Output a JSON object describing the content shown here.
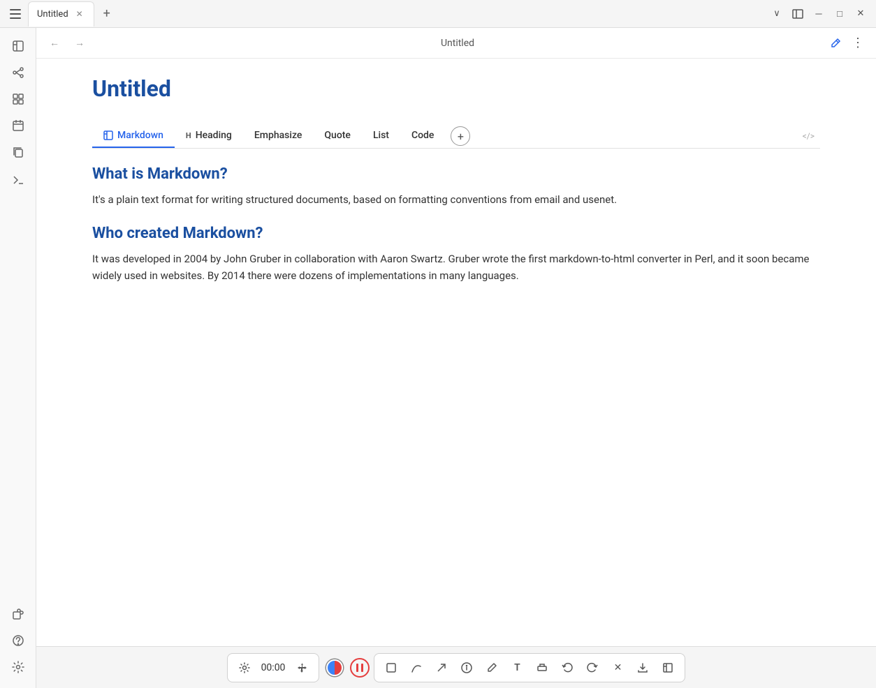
{
  "titleBar": {
    "tabTitle": "Untitled",
    "windowTitle": "Untitled",
    "sidebarToggleIcon": "▣",
    "chevronDownIcon": "∨",
    "layoutIcon": "⊞",
    "minimizeIcon": "─",
    "maximizeIcon": "□",
    "closeIcon": "✕",
    "newTabIcon": "+",
    "editIcon": "✎",
    "moreIcon": "⋮"
  },
  "sidebar": {
    "icons": [
      {
        "name": "pages-icon",
        "symbol": "⊡",
        "interactable": true
      },
      {
        "name": "connections-icon",
        "symbol": "⚯",
        "interactable": true
      },
      {
        "name": "blocks-icon",
        "symbol": "⊞",
        "interactable": true
      },
      {
        "name": "calendar-icon",
        "symbol": "▦",
        "interactable": true
      },
      {
        "name": "copy-icon",
        "symbol": "⧉",
        "interactable": true
      },
      {
        "name": "terminal-icon",
        "symbol": ">_",
        "interactable": true
      }
    ],
    "bottomIcons": [
      {
        "name": "plugin-icon",
        "symbol": "⊕",
        "interactable": true
      },
      {
        "name": "help-icon",
        "symbol": "?",
        "interactable": true
      },
      {
        "name": "settings-icon",
        "symbol": "⚙",
        "interactable": true
      }
    ]
  },
  "nav": {
    "backLabel": "←",
    "forwardLabel": "→",
    "title": "Untitled"
  },
  "document": {
    "title": "Untitled",
    "tabs": [
      {
        "id": "markdown",
        "label": "Markdown",
        "icon": "□",
        "active": true
      },
      {
        "id": "heading",
        "label": "Heading",
        "prefix": "H"
      },
      {
        "id": "emphasize",
        "label": "Emphasize"
      },
      {
        "id": "quote",
        "label": "Quote"
      },
      {
        "id": "list",
        "label": "List"
      },
      {
        "id": "code",
        "label": "Code"
      }
    ],
    "codeToggle": "</>",
    "addTabIcon": "+",
    "sections": [
      {
        "heading": "What is Markdown?",
        "body": "It's a plain text format for writing structured documents, based on formatting conventions from email and usenet."
      },
      {
        "heading": "Who created Markdown?",
        "body": "It was developed in 2004 by John Gruber in collaboration with Aaron Swartz. Gruber wrote the first markdown-to-html converter in Perl, and it soon became widely used in websites. By 2014 there were dozens of implementations in many languages."
      }
    ]
  },
  "bottomToolbar": {
    "timer": "00:00",
    "tools": [
      {
        "name": "settings-tool",
        "symbol": "⚙"
      },
      {
        "name": "move-tool",
        "symbol": "✛"
      },
      {
        "name": "select-tool",
        "symbol": "⬚"
      },
      {
        "name": "curve-tool",
        "symbol": "↝"
      },
      {
        "name": "arrow-tool",
        "symbol": "↗"
      },
      {
        "name": "info-tool",
        "symbol": "ⓘ"
      },
      {
        "name": "pen-tool",
        "symbol": "✏"
      },
      {
        "name": "text-tool",
        "symbol": "T"
      },
      {
        "name": "highlight-tool",
        "symbol": "▱"
      },
      {
        "name": "undo-tool",
        "symbol": "↩"
      },
      {
        "name": "redo-tool",
        "symbol": "↪"
      },
      {
        "name": "close-tool",
        "symbol": "✕"
      },
      {
        "name": "download-tool",
        "symbol": "↓"
      },
      {
        "name": "expand-tool",
        "symbol": "⊡"
      }
    ]
  }
}
